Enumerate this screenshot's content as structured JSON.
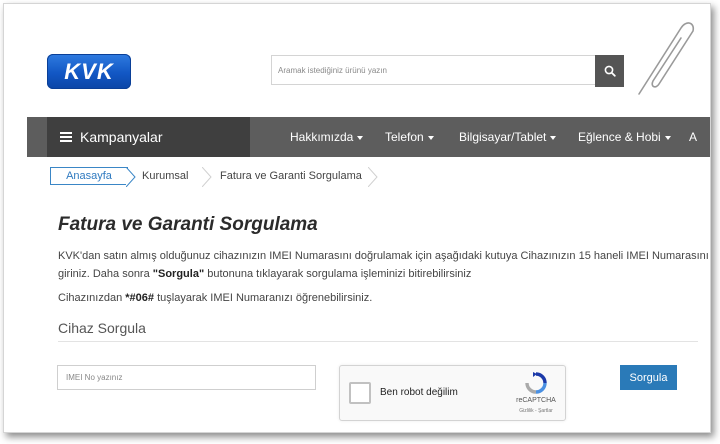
{
  "brand": {
    "logo_text": "KVK",
    "color": "#1a5fca"
  },
  "search": {
    "placeholder": "Aramak istediğiniz ürünü yazın",
    "button_icon": "search-icon"
  },
  "nav": {
    "campaign_label": "Kampanyalar",
    "items": [
      {
        "label": "Hakkımızda"
      },
      {
        "label": "Telefon"
      },
      {
        "label": "Bilgisayar/Tablet"
      },
      {
        "label": "Eğlence & Hobi"
      },
      {
        "label": "A"
      }
    ]
  },
  "breadcrumb": [
    "Anasayfa",
    "Kurumsal",
    "Fatura ve Garanti Sorgulama"
  ],
  "page": {
    "title": "Fatura ve Garanti Sorgulama",
    "intro_line1": "KVK'dan satın almış olduğunuz cihazınızın IMEI Numarasını doğrulamak için aşağıdaki kutuya Cihazınızın 15 haneli IMEI Numarasını",
    "intro_line2_prefix": "giriniz. Daha sonra ",
    "intro_line2_bold": "\"Sorgula\"",
    "intro_line2_suffix": " butonuna tıklayarak sorgulama işleminizi bitirebilirsiniz",
    "hint_prefix": "Cihazınızdan ",
    "hint_code": "*#06#",
    "hint_suffix": " tuşlayarak IMEI Numaranızı öğrenebilirsiniz."
  },
  "form": {
    "section_title": "Cihaz Sorgula",
    "imei_placeholder": "IMEI No yazınız",
    "imei_value": "",
    "captcha_label": "Ben robot değilim",
    "captcha_brand": "reCAPTCHA",
    "captcha_links": "Gizlilik - Şartlar",
    "submit_label": "Sorgula"
  },
  "colors": {
    "nav_bg": "#5d5d5d",
    "nav_campaign_bg": "#3f3f3f",
    "accent": "#2a7ab8"
  }
}
